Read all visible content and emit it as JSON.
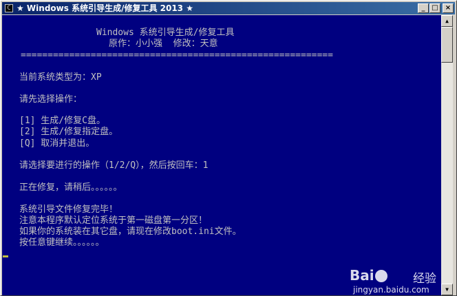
{
  "window": {
    "title": "★ Windows 系统引导生成/修复工具 2013 ★",
    "minimize_glyph": "_",
    "maximize_glyph": "□",
    "close_glyph": "×",
    "icon": "console-icon"
  },
  "console": {
    "header_title": "Windows 系统引导生成/修复工具",
    "header_credits": "原作：小小强  修改：天意",
    "separator": "==========================================================",
    "system_type": "当前系统类型为：XP",
    "choose_prompt": "请先选择操作：",
    "option_1": "[1] 生成/修复C盘。",
    "option_2": "[2] 生成/修复指定盘。",
    "option_q": "[Q] 取消并退出。",
    "select_prompt": "请选择要进行的操作（1/2/Q），然后按回车：1",
    "repairing": "正在修复，请稍后。。。。。。",
    "done": "系统引导文件修复完毕！",
    "note_1": "注意本程序默认定位系统于第一磁盘第一分区！",
    "note_2": "如果你的系统装在其它盘，请现在修改boot.ini文件。",
    "press_key": "按任意键继续。。。。。。"
  },
  "watermark": {
    "brand_left": "Bai",
    "brand_right": "经验",
    "url": "jingyan.baidu.com"
  },
  "colors": {
    "console_bg": "#000080",
    "console_fg": "#c0c0c0",
    "titlebar_start": "#0a246a",
    "titlebar_end": "#3a6ea5"
  }
}
